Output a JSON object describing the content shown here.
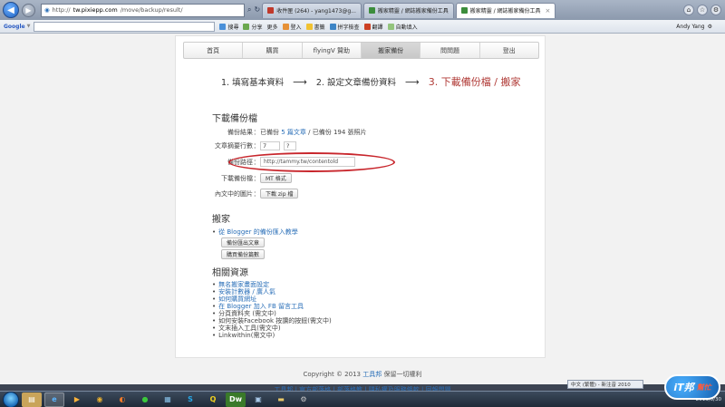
{
  "browser": {
    "address_prefix": "http://",
    "address_host": "tw.pixiepp.com",
    "address_path": "/move/backup/result/",
    "tabs": [
      {
        "label": "收件匣 (264) - yang1473@g..."
      },
      {
        "label": "搬家精靈 / 網誌搬家備份工具"
      },
      {
        "label": "搬家精靈 / 網誌搬家備份工具"
      }
    ]
  },
  "toolbar": {
    "search_engine": "Google",
    "items": [
      "搜尋",
      "分享",
      "更多",
      "登入",
      "書籤",
      "拼字檢查",
      "翻譯",
      "自動填入"
    ],
    "user_name": "Andy Yang"
  },
  "menu": {
    "items": [
      "首頁",
      "購買",
      "flyingV 贊助",
      "搬家備份",
      "問問題",
      "登出"
    ]
  },
  "steps": {
    "step1": "1. 填寫基本資料",
    "step2": "2. 設定文章備份資料",
    "step3": "3. 下載備份檔 / 搬家",
    "arrow": "⟶"
  },
  "download": {
    "title": "下載備份檔",
    "result_label": "備份結果",
    "result_prefix": "已備份",
    "result_count": "5 篇文章",
    "result_suffix": "/ 已備份 194 張照片",
    "summary_label": "文章摘要行數",
    "summary_value": "7",
    "summary_help": "?",
    "path_label": "備份路徑",
    "path_value": "http://tammy.tw/contentold",
    "file_label": "下載備份檔",
    "file_button": "MT 格式",
    "images_label": "內文中的圖片",
    "images_button": "下載 zip 檔"
  },
  "move": {
    "title": "搬家",
    "link": "從 Blogger 的備份匯入教學",
    "button1": "備份匯出文章",
    "button2": "購買備份篇數"
  },
  "resources": {
    "title": "相關資源",
    "items": [
      {
        "text": "無名搬家畫面設定",
        "link": true
      },
      {
        "text": "安裝計數器 / 廣人氣",
        "link": true
      },
      {
        "text": "如何購買網址",
        "link": true
      },
      {
        "text": "在 Blogger 加入 FB 留言工具",
        "link": true
      },
      {
        "text": "分頁資料夾 (需文中)",
        "link": false
      },
      {
        "text": "如何安裝Facebook 按讚的按鈕(需文中)",
        "link": false
      },
      {
        "text": "文末插入工具(需文中)",
        "link": false
      },
      {
        "text": "Linkwithin(需文中)",
        "link": false
      }
    ]
  },
  "footer": {
    "copyright": "Copyright © 2013",
    "brand": "工具邦",
    "rights": "保留一切權利",
    "links": "工具邦 | 官方部落格 | 部落格教 | 隱私權及服務條款 | 回報問題"
  },
  "taskbar": {
    "ime": "中文 (繁體) - 新注音 2010",
    "clock": "2013/5/30"
  },
  "watermark": {
    "main": "iT邦",
    "sub": "幫忙"
  }
}
